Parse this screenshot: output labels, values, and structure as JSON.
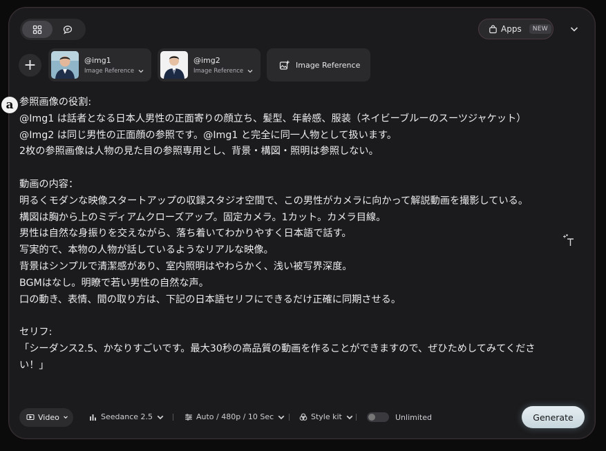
{
  "header": {
    "view_toggle": [
      {
        "icon": "grid-icon",
        "active": true
      },
      {
        "icon": "chat-bubble-icon",
        "active": false
      }
    ],
    "apps_label": "Apps",
    "apps_badge": "NEW"
  },
  "references": {
    "items": [
      {
        "name": "@img1",
        "type_label": "Image Reference"
      },
      {
        "name": "@img2",
        "type_label": "Image Reference"
      }
    ],
    "add_label": "+",
    "image_reference_button": "Image Reference"
  },
  "side_badge": "a",
  "prompt": {
    "text": "参照画像の役割:\n@Img1 は話者となる日本人男性の正面寄りの顔立ち、髪型、年齢感、服装（ネイビーブルーのスーツジャケット）\n@Img2 は同じ男性の正面顔の参照です。@Img1 と完全に同一人物として扱います。\n2枚の参照画像は人物の見た目の参照専用とし、背景・構図・照明は参照しない。\n\n動画の内容：\n明るくモダンな映像スタートアップの収録スタジオ空間で、この男性がカメラに向かって解説動画を撮影している。\n構図は胸から上のミディアムクローズアップ。固定カメラ。1カット。カメラ目線。\n男性は自然な身振りを交えながら、落ち着いてわかりやすく日本語で話す。\n写実的で、本物の人物が話しているようなリアルな映像。\n背景はシンプルで清潔感があり、室内照明はやわらかく、浅い被写界深度。\nBGMはなし。明瞭で若い男性の自然な声。\n口の動き、表情、間の取り方は、下記の日本語セリフにできるだけ正確に同期させる。\n\nセリフ:\n「シーダンス2.5、かなりすごいです。最大30秒の高品質の動画を作ることができますので、ぜひためしてみてください！」"
  },
  "toolbar": {
    "mode_label": "Video",
    "model_label": "Seedance 2.5",
    "settings_label": "Auto / 480p / 10 Sec",
    "style_label": "Style kit",
    "unlimited_label": "Unlimited",
    "unlimited_on": false,
    "generate_label": "Generate"
  },
  "colors": {
    "panel_bg": "#1b1b1d",
    "control_bg": "#2a2a2d",
    "generate_bg": "#d6e3e9"
  }
}
